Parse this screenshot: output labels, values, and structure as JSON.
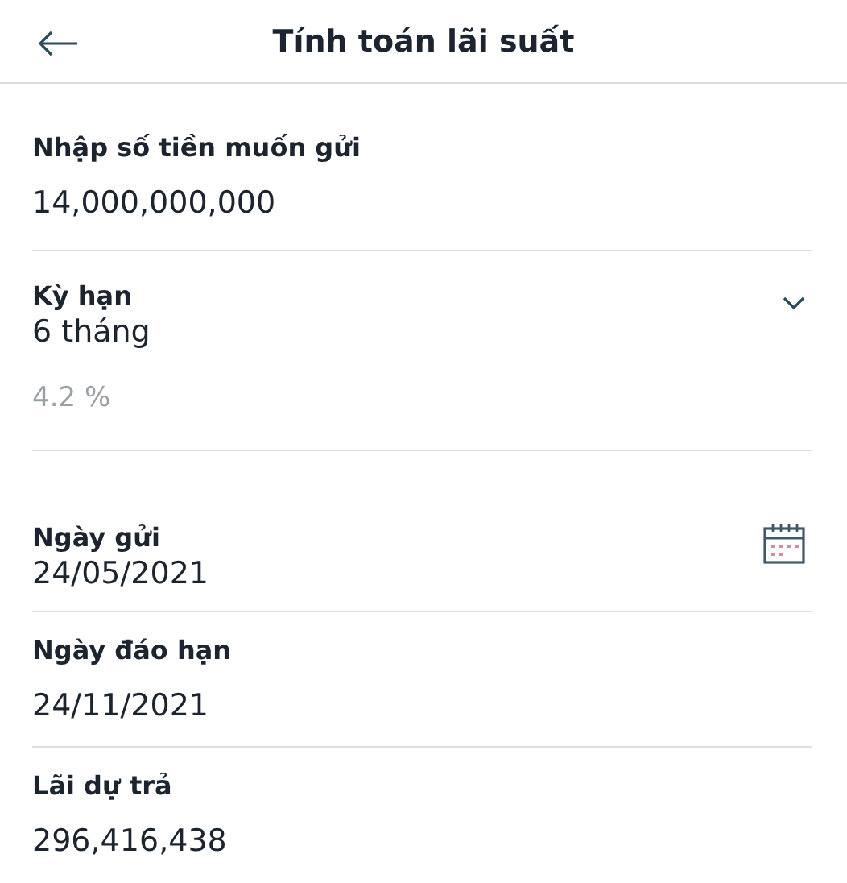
{
  "header": {
    "title": "Tính toán lãi suất"
  },
  "fields": [
    {
      "kind": "text",
      "label": "Nhập số tiền muốn gửi",
      "value": "14,000,000,000"
    },
    {
      "kind": "select",
      "label": "Kỳ hạn",
      "value": "6 tháng",
      "note": "4.2 %"
    },
    {
      "kind": "date",
      "label": "Ngày gửi",
      "value": "24/05/2021"
    },
    {
      "kind": "text",
      "label": "Ngày đáo hạn",
      "value": "24/11/2021"
    },
    {
      "kind": "text",
      "label": "Lãi dự trả",
      "value": "296,416,438"
    }
  ]
}
